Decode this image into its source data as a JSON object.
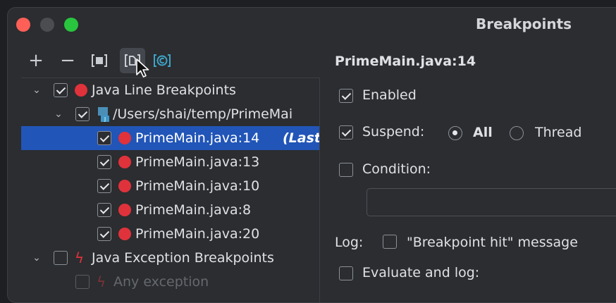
{
  "window": {
    "title": "Breakpoints"
  },
  "toolbar": {
    "add": "+",
    "remove": "−"
  },
  "tree": {
    "java_line": {
      "label": "Java Line Breakpoints"
    },
    "file_group": {
      "label": "/Users/shai/temp/PrimeMai"
    },
    "breakpoints": [
      {
        "label": "PrimeMain.java:14",
        "suffix": "(Last",
        "checked": true,
        "selected": true
      },
      {
        "label": "PrimeMain.java:13",
        "checked": true
      },
      {
        "label": "PrimeMain.java:10",
        "checked": true
      },
      {
        "label": "PrimeMain.java:8",
        "checked": true
      },
      {
        "label": "PrimeMain.java:20",
        "checked": true
      }
    ],
    "java_exception": {
      "label": "Java Exception Breakpoints"
    },
    "any_exception": {
      "label": "Any exception"
    }
  },
  "details": {
    "title": "PrimeMain.java:14",
    "enabled": "Enabled",
    "suspend": "Suspend:",
    "suspend_all": "All",
    "suspend_thread": "Thread",
    "condition": "Condition:",
    "log": "Log:",
    "log_message": "\"Breakpoint hit\" message",
    "evaluate": "Evaluate and log:"
  },
  "colors": {
    "accent": "#2155b7",
    "breakpoint": "#e0323b"
  }
}
